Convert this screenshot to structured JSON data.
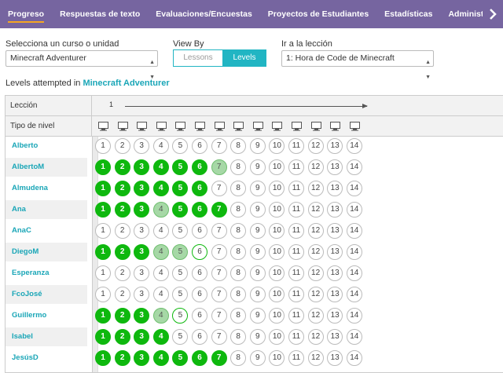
{
  "nav": {
    "tabs": [
      "Progreso",
      "Respuestas de texto",
      "Evaluaciones/Encuestas",
      "Proyectos de Estudiantes",
      "Estadísticas",
      "Administr"
    ],
    "active": 0,
    "arrow_icon": "chevron-right-icon"
  },
  "selectors": {
    "course_label": "Selecciona un curso o unidad",
    "course_value": "Minecraft Adventurer",
    "viewby_label": "View By",
    "lessons": "Lessons",
    "levels": "Levels",
    "jump_label": "Ir a la lección",
    "jump_value": "1: Hora de Code de Minecraft"
  },
  "attempted": {
    "prefix": "Levels attempted in ",
    "course": "Minecraft Adventurer"
  },
  "table": {
    "lesson_header": "Lección",
    "level_type_header": "Tipo de nivel",
    "lesson_number": "1",
    "level_icon": "computer-icon",
    "level_count": 14,
    "colors": {
      "perfect": "#0eb80e",
      "attempted": "#a6d8a6",
      "teal": "#1aa6b7"
    },
    "students": [
      {
        "name": "Alberto",
        "perfect": 0,
        "attempted": [],
        "started": []
      },
      {
        "name": "AlbertoM",
        "perfect": 6,
        "attempted": [
          7
        ],
        "started": []
      },
      {
        "name": "Almudena",
        "perfect": 6,
        "attempted": [],
        "started": []
      },
      {
        "name": "Ana",
        "perfect": 3,
        "attempted": [
          4
        ],
        "started": [],
        "perfect_extra": [
          5,
          6,
          7
        ]
      },
      {
        "name": "AnaC",
        "perfect": 0,
        "attempted": [],
        "started": []
      },
      {
        "name": "DiegoM",
        "perfect": 3,
        "attempted": [
          4,
          5
        ],
        "started": [
          6
        ]
      },
      {
        "name": "Esperanza",
        "perfect": 0,
        "attempted": [],
        "started": []
      },
      {
        "name": "FcoJosé",
        "perfect": 0,
        "attempted": [],
        "started": []
      },
      {
        "name": "Guillermo",
        "perfect": 3,
        "attempted": [
          4
        ],
        "started": [
          5
        ]
      },
      {
        "name": "Isabel",
        "perfect": 4,
        "attempted": [],
        "started": []
      },
      {
        "name": "JesúsD",
        "perfect": 7,
        "attempted": [],
        "started": []
      }
    ]
  }
}
